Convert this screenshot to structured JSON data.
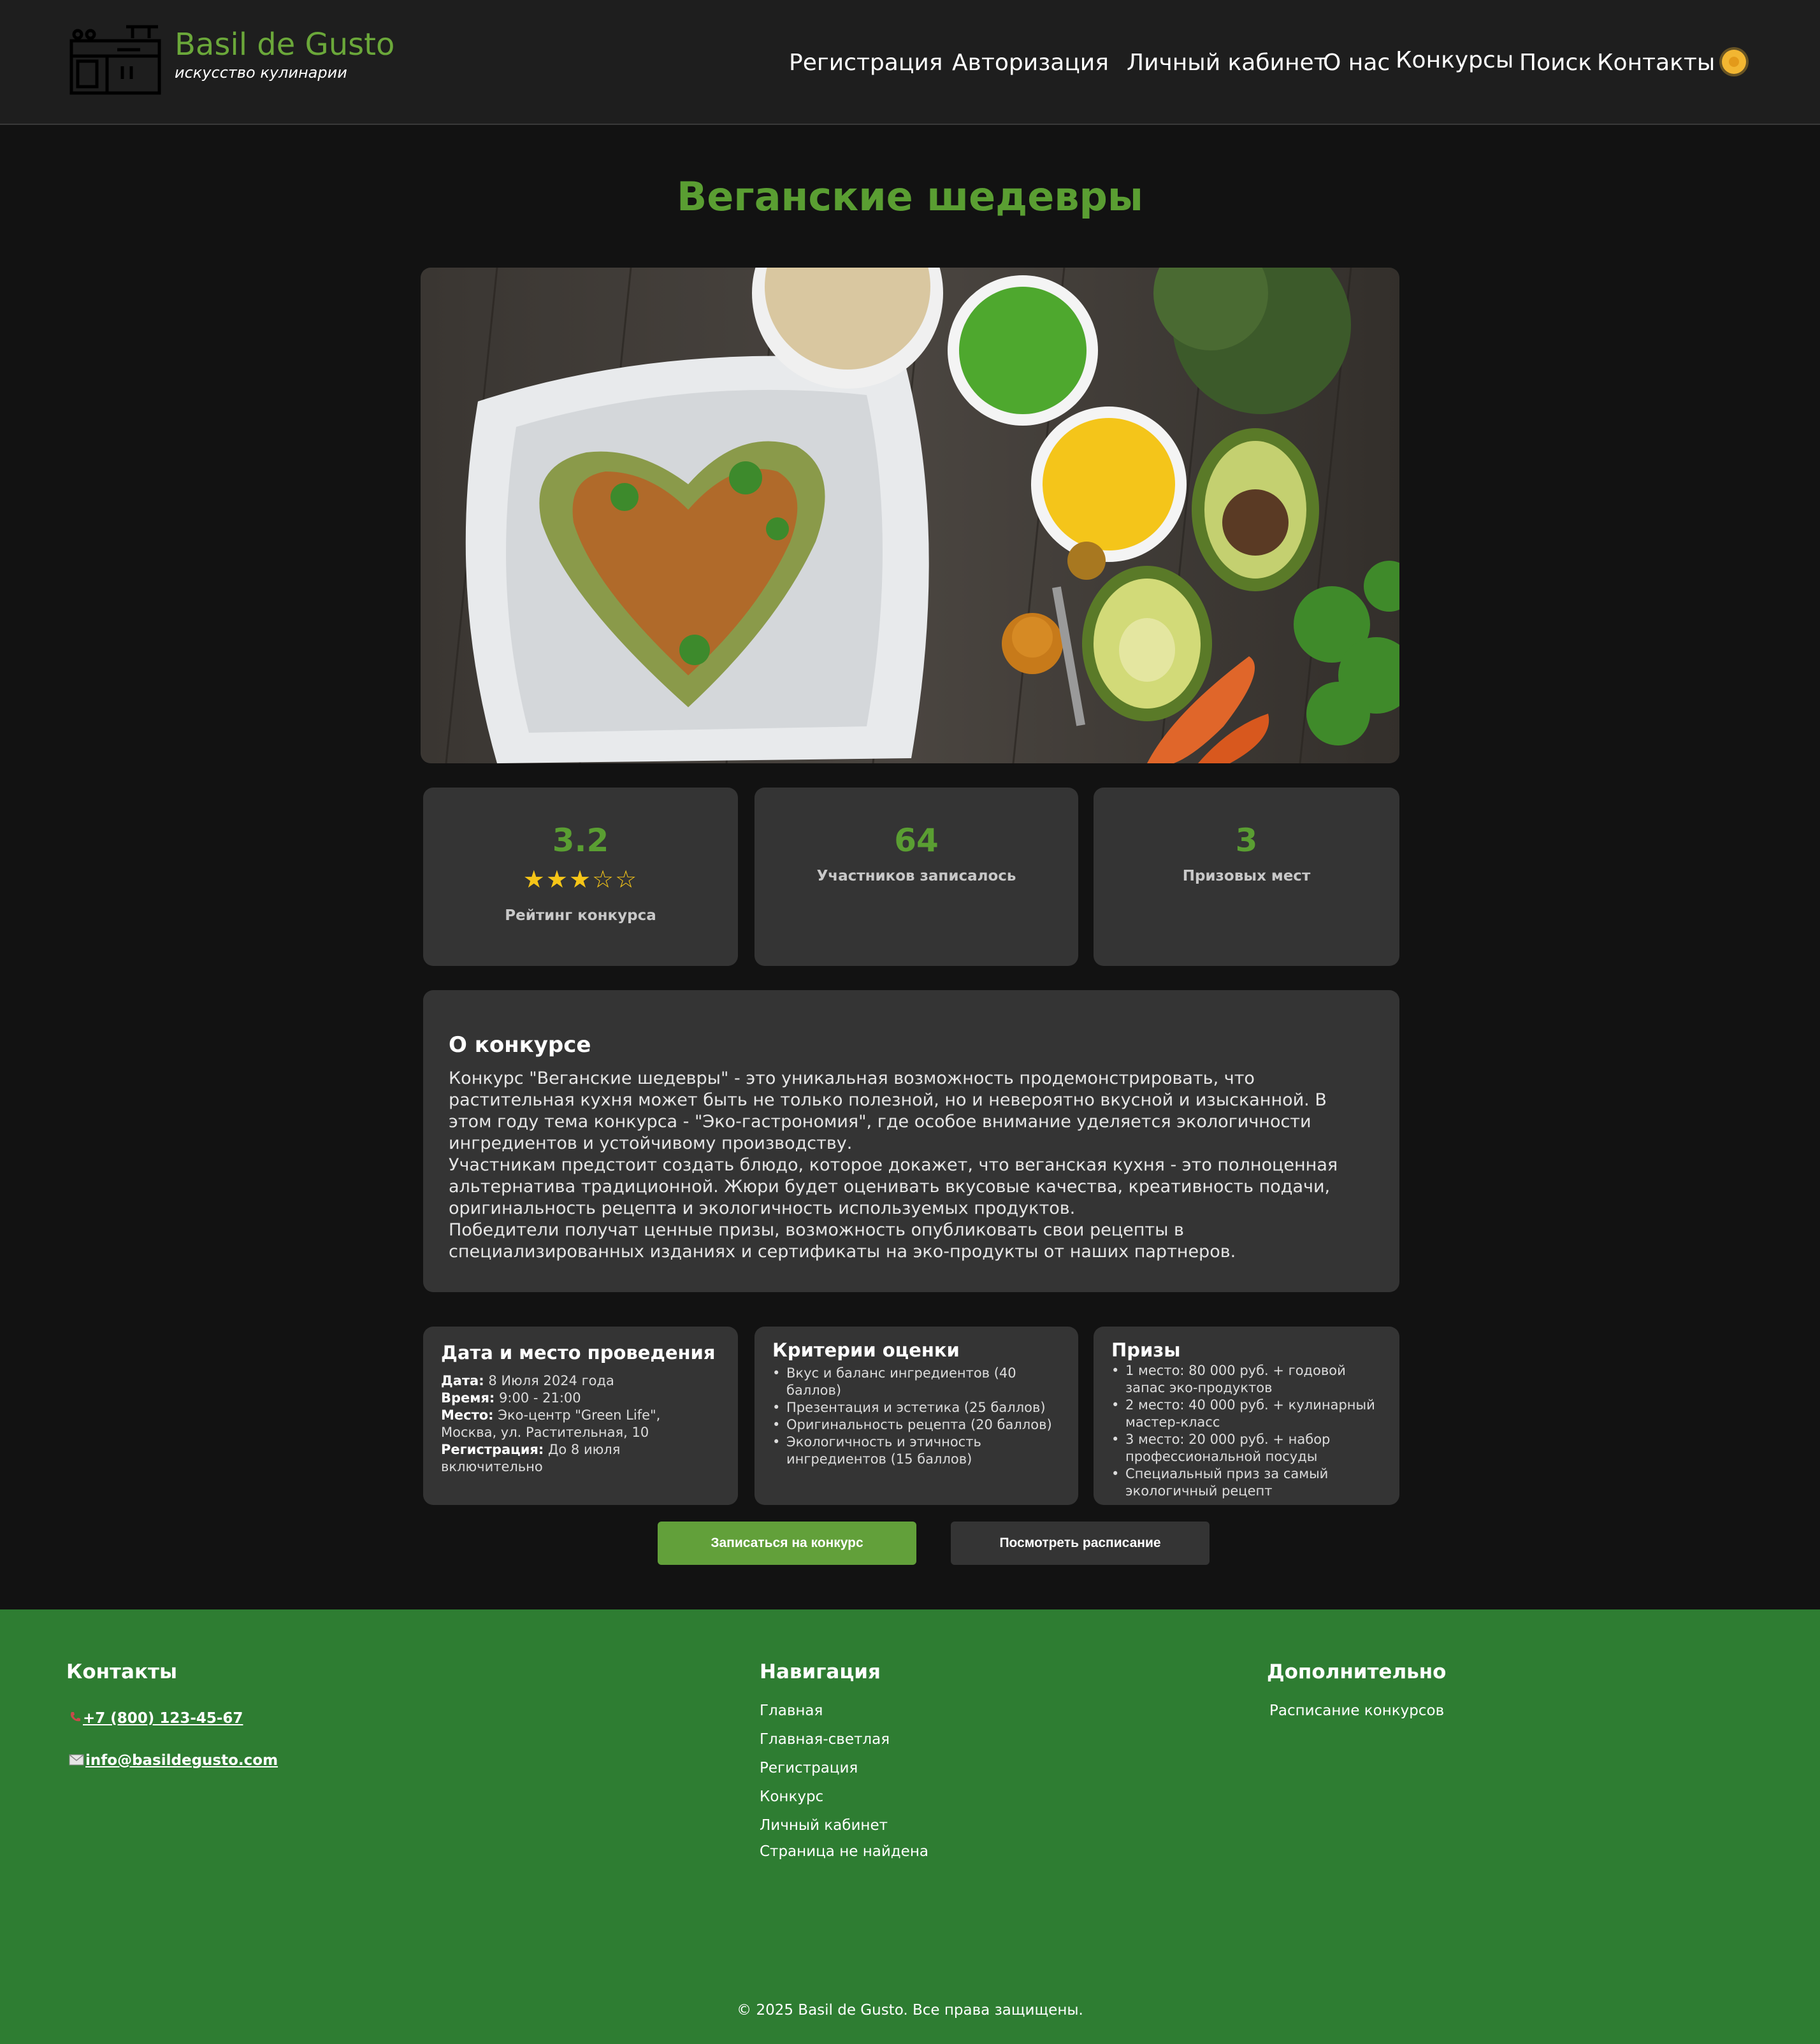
{
  "header": {
    "brand_name": "Basil de Gusto",
    "tagline": "искусство кулинарии",
    "nav": {
      "register": "Регистрация",
      "login": "Авторизация",
      "account": "Личный кабинет",
      "about": "О нас",
      "contests": "Конкурсы",
      "search": "Поиск",
      "contacts": "Контакты"
    },
    "theme_icon": "sun-icon"
  },
  "page": {
    "title": "Веганские шедевры",
    "hero_image": "vegan-heart-dish-photo"
  },
  "stats": {
    "rating": {
      "value": "3.2",
      "stars_filled": 3,
      "stars_total": 5,
      "label": "Рейтинг конкурса"
    },
    "participants": {
      "value": "64",
      "label": "Участников записалось"
    },
    "prizes": {
      "value": "3",
      "label": "Призовых мест"
    }
  },
  "about": {
    "heading": "О конкурсе",
    "p1": "Конкурс \"Веганские шедевры\" - это уникальная возможность продемонстрировать, что растительная кухня может быть не только полезной, но и невероятно вкусной и изысканной. В этом году тема конкурса - \"Эко-гастрономия\", где особое внимание уделяется экологичности ингредиентов и устойчивому производству.",
    "p2": "Участникам предстоит создать блюдо, которое докажет, что веганская кухня - это полноценная альтернатива традиционной. Жюри будет оценивать вкусовые качества, креативность подачи, оригинальность рецепта и экологичность используемых продуктов.",
    "p3": "Победители получат ценные призы, возможность опубликовать свои рецепты в специализированных изданиях и сертификаты на эко-продукты от наших партнеров."
  },
  "details": {
    "heading": "Дата и место проведения",
    "date_label": "Дата:",
    "date_value": "8 Июля 2024 года",
    "time_label": "Время:",
    "time_value": "9:00 - 21:00",
    "place_label": "Место:",
    "place_value": "Эко-центр \"Green Life\", Москва, ул. Растительная, 10",
    "reg_label": "Регистрация:",
    "reg_value": "До 8 июля включительно"
  },
  "criteria": {
    "heading": "Критерии оценки",
    "items": [
      "Вкус и баланс ингредиентов (40 баллов)",
      "Презентация и эстетика (25 баллов)",
      "Оригинальность рецепта (20 баллов)",
      "Экологичность и этичность ингредиентов (15 баллов)"
    ]
  },
  "prizes": {
    "heading": "Призы",
    "items": [
      "1 место: 80 000 руб. + годовой запас эко-продуктов",
      "2 место: 40 000 руб. + кулинарный мастер-класс",
      "3 место: 20 000 руб. + набор профессиональной посуды",
      "Специальный приз за самый экологичный рецепт"
    ]
  },
  "actions": {
    "signup": "Записаться на конкурс",
    "schedule": "Посмотреть расписание"
  },
  "footer": {
    "contacts_heading": "Контакты",
    "phone": "+7 (800) 123-45-67",
    "email": "info@basildegusto.com",
    "nav_heading": "Навигация",
    "nav_items": [
      "Главная",
      "Главная-светлая",
      "Регистрация",
      "Конкурс",
      "Личный кабинет",
      "Страница не найдена"
    ],
    "extra_heading": "Дополнительно",
    "extra_items": [
      "Расписание конкурсов"
    ],
    "copyright": "© 2025 Basil de Gusto. Все права защищены."
  },
  "colors": {
    "accent_green": "#5a9e32",
    "footer_green": "#2e7d32",
    "card_bg": "#343434",
    "page_bg": "#121212",
    "star": "#f5c518"
  }
}
